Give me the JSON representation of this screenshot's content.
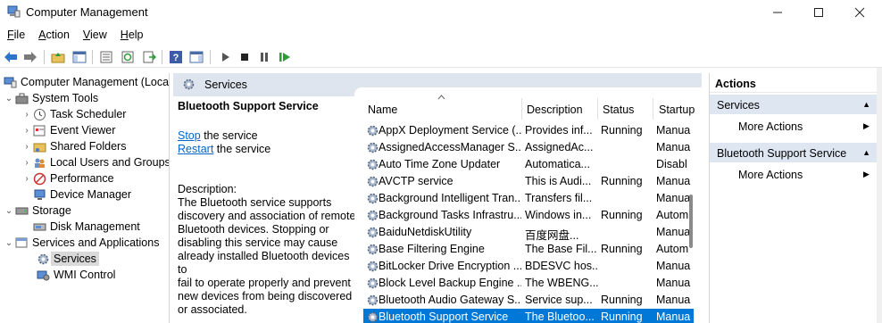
{
  "window": {
    "title": "Computer Management"
  },
  "menu": [
    {
      "label": "File",
      "u": "F",
      "rest": "ile"
    },
    {
      "label": "Action",
      "u": "A",
      "rest": "ction"
    },
    {
      "label": "View",
      "u": "V",
      "rest": "iew"
    },
    {
      "label": "Help",
      "u": "H",
      "rest": "elp"
    }
  ],
  "tree": {
    "root": "Computer Management (Local",
    "system_tools": "System Tools",
    "task_scheduler": "Task Scheduler",
    "event_viewer": "Event Viewer",
    "shared_folders": "Shared Folders",
    "local_users": "Local Users and Groups",
    "performance": "Performance",
    "device_manager": "Device Manager",
    "storage": "Storage",
    "disk_management": "Disk Management",
    "services_apps": "Services and Applications",
    "services": "Services",
    "wmi": "WMI Control"
  },
  "center": {
    "header": "Services",
    "selected_service": "Bluetooth Support Service",
    "stop_link": "Stop",
    "stop_rest": " the service",
    "restart_link": "Restart",
    "restart_rest": " the service",
    "description_label": "Description:",
    "description_lines": [
      "The Bluetooth service supports",
      "discovery and association of remote",
      "Bluetooth devices.  Stopping or",
      "disabling this service may cause",
      "already installed Bluetooth devices to",
      "fail to operate properly and prevent",
      "new devices from being discovered",
      "or associated."
    ]
  },
  "columns": {
    "name": "Name",
    "description": "Description",
    "status": "Status",
    "startup": "Startup"
  },
  "services": [
    {
      "name": "AppX Deployment Service (...",
      "desc": "Provides inf...",
      "status": "Running",
      "startup": "Manua"
    },
    {
      "name": "AssignedAccessManager S...",
      "desc": "AssignedAc...",
      "status": "",
      "startup": "Manua"
    },
    {
      "name": "Auto Time Zone Updater",
      "desc": "Automatica...",
      "status": "",
      "startup": "Disabl"
    },
    {
      "name": "AVCTP service",
      "desc": "This is Audi...",
      "status": "Running",
      "startup": "Manua"
    },
    {
      "name": "Background Intelligent Tran...",
      "desc": "Transfers fil...",
      "status": "",
      "startup": "Manua"
    },
    {
      "name": "Background Tasks Infrastru...",
      "desc": "Windows in...",
      "status": "Running",
      "startup": "Autom"
    },
    {
      "name": "BaiduNetdiskUtility",
      "desc": "百度网盘...",
      "status": "",
      "startup": "Manua"
    },
    {
      "name": "Base Filtering Engine",
      "desc": "The Base Fil...",
      "status": "Running",
      "startup": "Autom"
    },
    {
      "name": "BitLocker Drive Encryption ...",
      "desc": "BDESVC hos...",
      "status": "",
      "startup": "Manua"
    },
    {
      "name": "Block Level Backup Engine ...",
      "desc": "The WBENG...",
      "status": "",
      "startup": "Manua"
    },
    {
      "name": "Bluetooth Audio Gateway S...",
      "desc": "Service sup...",
      "status": "Running",
      "startup": "Manua"
    },
    {
      "name": "Bluetooth Support Service",
      "desc": "The Bluetoo...",
      "status": "Running",
      "startup": "Manua",
      "selected": true
    }
  ],
  "actions": {
    "title": "Actions",
    "group1": "Services",
    "more1": "More Actions",
    "group2": "Bluetooth Support Service",
    "more2": "More Actions"
  },
  "colors": {
    "selection": "#0078d7",
    "header_band": "#dfe5ee",
    "action_group": "#dde6f1"
  },
  "icons": [
    "app-icon",
    "back-icon",
    "forward-icon",
    "up-folder-icon",
    "show-hide-tree-icon",
    "properties-icon",
    "refresh-icon",
    "export-icon",
    "help-icon",
    "show-hide-action-icon",
    "play-icon",
    "stop-icon",
    "pause-icon",
    "resume-icon",
    "gear-icon"
  ]
}
